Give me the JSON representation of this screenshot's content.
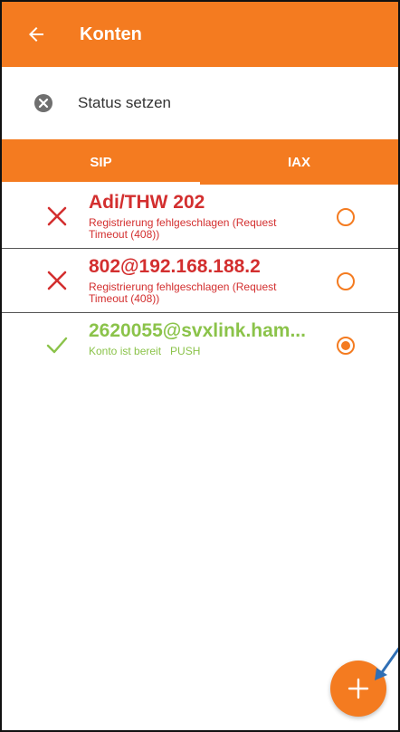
{
  "appbar": {
    "title": "Konten"
  },
  "status": {
    "label": "Status setzen"
  },
  "tabs": [
    {
      "label": "SIP",
      "active": true
    },
    {
      "label": "IAX",
      "active": false
    }
  ],
  "accounts": [
    {
      "name": "Adi/THW 202",
      "status": "Registrierung fehlgeschlagen (Request Timeout (408))",
      "state": "error",
      "selected": false
    },
    {
      "name": "802@192.168.188.2",
      "status": "Registrierung fehlgeschlagen (Request Timeout (408))",
      "state": "error",
      "selected": false
    },
    {
      "name": "2620055@svxlink.ham...",
      "status": "Konto ist bereit   PUSH",
      "state": "ready",
      "selected": true
    }
  ],
  "colors": {
    "accent": "#f47b20",
    "error": "#d32f2f",
    "ready": "#8bc34a"
  }
}
